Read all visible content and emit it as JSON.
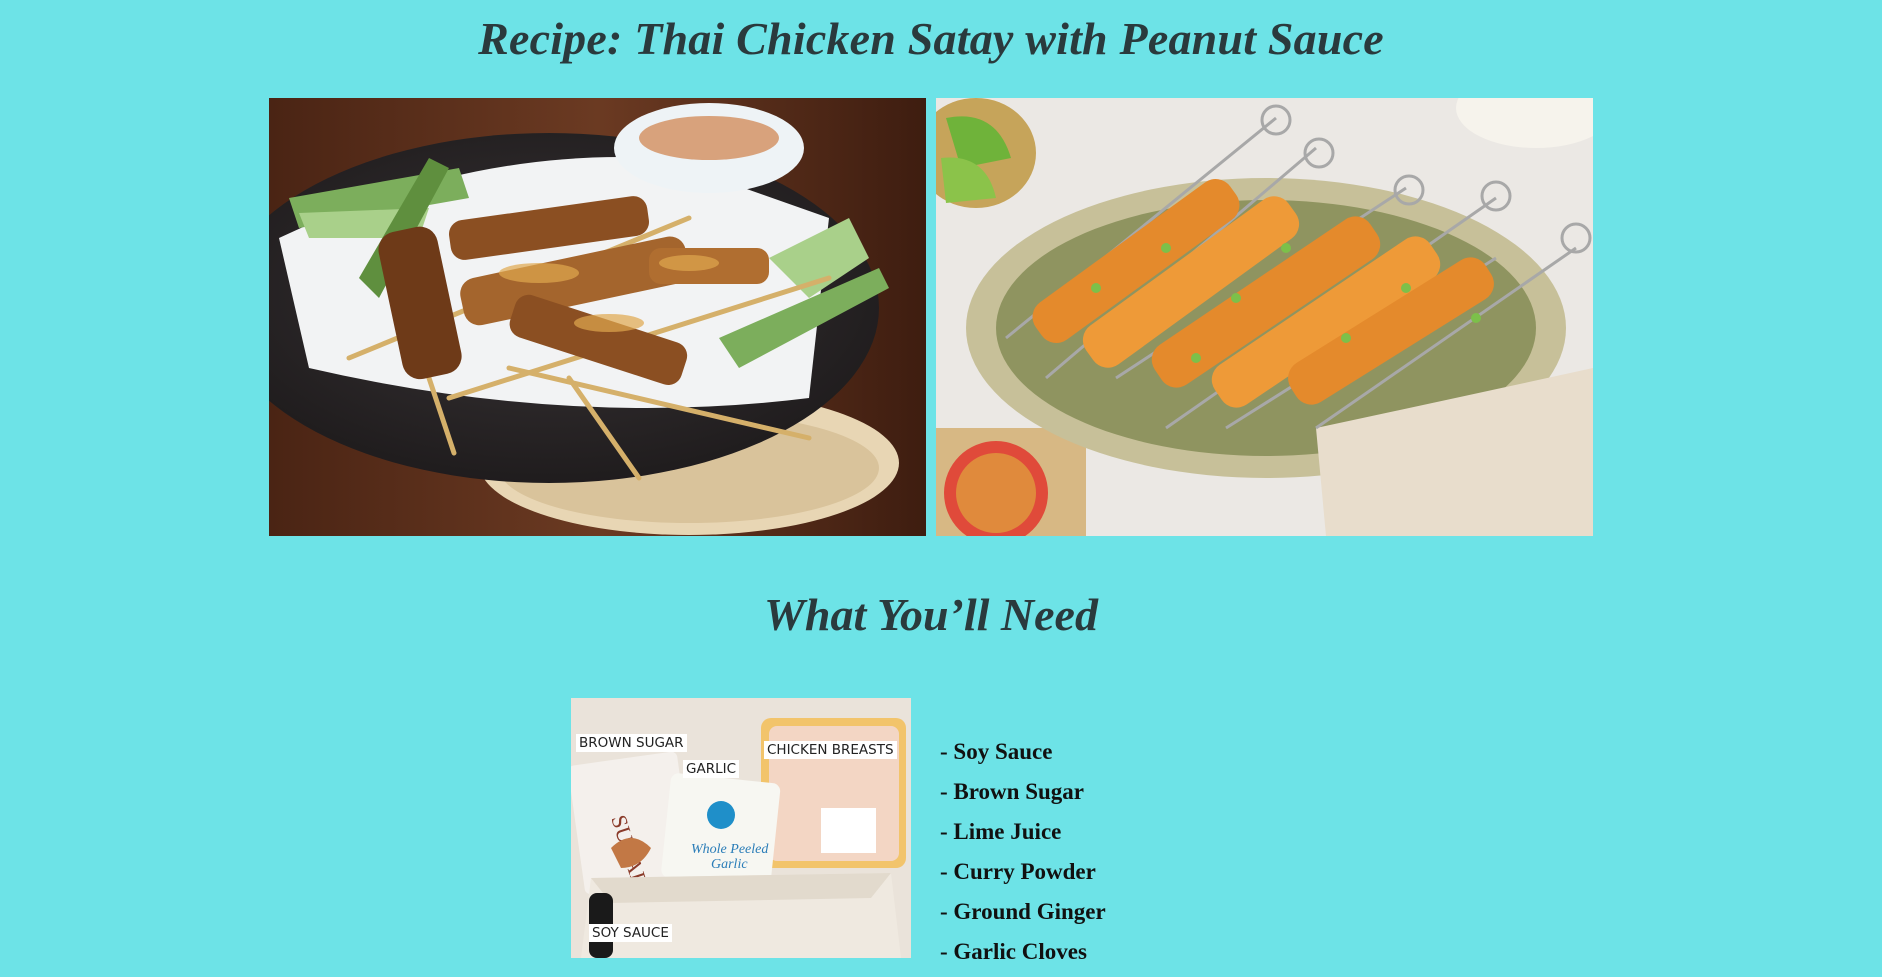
{
  "recipe": {
    "title": "Recipe: Thai Chicken Satay with Peanut Sauce"
  },
  "photos": [
    {
      "name": "satay-plate-photo"
    },
    {
      "name": "satay-platter-photo"
    }
  ],
  "ingredients_section": {
    "heading": "What You’ll Need",
    "photo_tags": {
      "brown_sugar": "BROWN SUGAR",
      "garlic": "GARLIC",
      "chicken": "CHICKEN BREASTS",
      "soy_sauce": "SOY SAUCE"
    },
    "items": [
      "- Soy Sauce",
      "- Brown Sugar",
      "- Lime Juice",
      "- Curry Powder",
      "- Ground Ginger",
      "- Garlic Cloves"
    ]
  },
  "colors": {
    "background": "#6de3e7",
    "heading": "#2a3a3d"
  }
}
